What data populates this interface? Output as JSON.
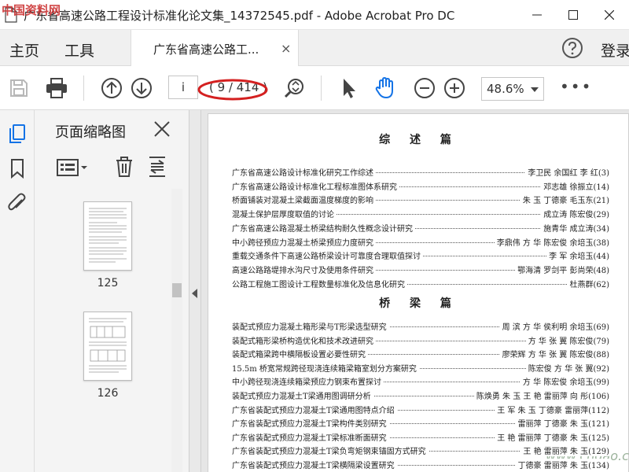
{
  "window": {
    "title": "广东省高速公路工程设计标准化论文集_14372545.pdf - Adobe Acrobat Pro DC",
    "watermark": "中国资料网"
  },
  "menubar": {
    "home": "主页",
    "tools": "工具",
    "tab_label": "广东省高速公路工...",
    "tab_close": "×",
    "login": "登录"
  },
  "toolbar": {
    "page_input": "i",
    "page_count": "( 9 / 414 )",
    "zoom": "48.6%",
    "more": "•••"
  },
  "panel": {
    "title": "页面缩略图",
    "thumbnails": [
      {
        "label": "125"
      },
      {
        "label": "126"
      }
    ]
  },
  "document": {
    "headings": [
      "综 述 篇",
      "桥 梁 篇"
    ],
    "section1": [
      {
        "title": "广东省高速公路设计标准化研究工作综述",
        "authors": "李卫民  余国红  李  红(3)"
      },
      {
        "title": "广东省高速公路设计标准化工程标准图体系研究",
        "authors": "邓志雄  徐振立(14)"
      },
      {
        "title": "桥面铺装对混凝土梁截面温度梯度的影响",
        "authors": "朱  玉  丁德豪  毛玉东(21)"
      },
      {
        "title": "混凝土保护层厚度取值的讨论",
        "authors": "成立涛  陈宏俊(29)"
      },
      {
        "title": "广东省高速公路混凝土桥梁结构耐久性概念设计研究",
        "authors": "施青华  成立涛(34)"
      },
      {
        "title": "中小跨径预应力混凝土桥梁预应力度研究",
        "authors": "李鼎伟  方  华  陈宏俊  余培玉(38)"
      },
      {
        "title": "重载交通条件下高速公路桥梁设计可靠度合理取值探讨",
        "authors": "李  军  余培玉(44)"
      },
      {
        "title": "高速公路路堤排水沟尺寸及使用条件研究",
        "authors": "鄂海清  罗剑平  彭尚荣(48)"
      },
      {
        "title": "公路工程施工图设计工程数量标准化及信息化研究",
        "authors": "杜燕群(62)"
      }
    ],
    "section2": [
      {
        "title": "装配式预应力混凝土箱形梁与T形梁选型研究",
        "authors": "周  滨  方  华  侯利明  余培玉(69)"
      },
      {
        "title": "装配式箱形梁桥构造优化和技术改进研究",
        "authors": "方  华  张  翼  陈宏俊(79)"
      },
      {
        "title": "装配式箱梁跨中横隔板设置必要性研究",
        "authors": "廖荣辉  方  华  张  翼  陈宏俊(88)"
      },
      {
        "title": "15.5m 桥宽常规跨径现浇连续箱梁箱室划分方案研究",
        "authors": "陈宏俊  方  华  张  翼(92)"
      },
      {
        "title": "中小跨径现浇连续箱梁预应力钢束布置探讨",
        "authors": "方  华  陈宏俊  余培玉(99)"
      },
      {
        "title": "装配式预应力混凝土T梁通用图调研分析",
        "authors": "陈焕勇  朱  玉  王  艳  雷丽萍  向  彤(106)"
      },
      {
        "title": "广东省装配式预应力混凝土T梁通用图特点介绍",
        "authors": "王  军  朱  玉  丁德豪  雷丽萍(112)"
      },
      {
        "title": "广东省装配式预应力混凝土T梁构件类别研究",
        "authors": "雷丽萍  丁德豪  朱  玉(121)"
      },
      {
        "title": "广东省装配式预应力混凝土T梁标准断面研究",
        "authors": "王  艳  雷丽萍  丁德豪  朱  玉(125)"
      },
      {
        "title": "广东省装配式预应力混凝土T梁负弯矩钢束锚固方式研究",
        "authors": "王  艳  雷丽萍  朱  玉(129)"
      },
      {
        "title": "广东省装配式预应力混凝土T梁横隔梁设置研究",
        "authors": "丁德豪  雷丽萍  朱  玉(134)"
      }
    ],
    "watermark": "www.cndao.com"
  },
  "colors": {
    "accent_blue": "#1473e6",
    "annotation_red": "#d42020"
  }
}
